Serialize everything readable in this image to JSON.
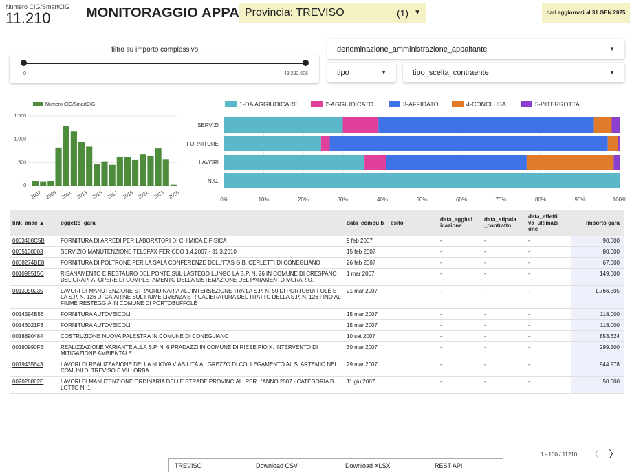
{
  "kpi": {
    "label": "Numero CIG/SmartCIG",
    "value": "11.210"
  },
  "header": {
    "title": "MONITORAGGIO APPALTI",
    "provincia_label": "Provincia: TREVISO",
    "provincia_count": "(1)",
    "updated": "dati aggiornati al 31.GEN.2025"
  },
  "filter": {
    "label": "filtro su importo complessivo",
    "min": "0",
    "max": "43.292.606",
    "position": [
      0,
      1
    ]
  },
  "dropdowns": {
    "amministrazione": "denominazione_amministrazione_appaltante",
    "tipo": "tipo",
    "scelta": "tipo_scelta_contraente"
  },
  "colors": {
    "bar_green": "#4c8c3b",
    "s1": "#5ab8c8",
    "s2": "#e0409a",
    "s3": "#3f72e6",
    "s4": "#e07b2c",
    "s5": "#8a3fcf"
  },
  "chart_data": [
    {
      "type": "bar",
      "legend": "Numero CIG/SmartCIG",
      "x": [
        2007,
        2008,
        2009,
        2010,
        2011,
        2012,
        2013,
        2014,
        2015,
        2016,
        2017,
        2018,
        2019,
        2020,
        2021,
        2022,
        2023,
        2024,
        2025
      ],
      "tick_labels": [
        "2007",
        "2009",
        "2011",
        "2013",
        "2015",
        "2017",
        "2019",
        "2021",
        "2023",
        "2025"
      ],
      "values": [
        90,
        80,
        95,
        820,
        1290,
        1170,
        950,
        840,
        470,
        510,
        450,
        610,
        620,
        550,
        680,
        640,
        800,
        560,
        20
      ],
      "yticks": [
        "0",
        "500",
        "1.000",
        "1.500"
      ],
      "ylim": [
        0,
        1500
      ]
    },
    {
      "type": "bar",
      "orientation": "horizontal-stacked-100",
      "categories": [
        "SERVIZI",
        "FORNITURE",
        "LAVORI",
        "N.C."
      ],
      "series": [
        {
          "name": "1-DA AGGIUDICARE",
          "values": [
            30,
            24.5,
            35.5,
            100
          ]
        },
        {
          "name": "2-AGGIUDICATO",
          "values": [
            9,
            2.2,
            5.5,
            0
          ]
        },
        {
          "name": "3-AFFIDATO",
          "values": [
            54.5,
            70.3,
            35.5,
            0
          ]
        },
        {
          "name": "4-CONCLUSA",
          "values": [
            4.5,
            2.5,
            22,
            0
          ]
        },
        {
          "name": "5-INTERROTTA",
          "values": [
            2,
            0.5,
            1.5,
            0
          ]
        }
      ],
      "xticks": [
        "0%",
        "10%",
        "20%",
        "30%",
        "40%",
        "50%",
        "60%",
        "70%",
        "80%",
        "90%",
        "100%"
      ],
      "xlim": [
        0,
        100
      ]
    }
  ],
  "table": {
    "headers": [
      "link_anac ▲",
      "oggetto_gara",
      "data_compu b",
      "esito",
      "data_aggiud icazione",
      "data_stipula _contratto",
      "data_effetti va_ultimazi one",
      "Importo gara"
    ],
    "rows": [
      [
        "0003408C5B",
        "FORNITURA DI ARREDI PER LABORATORI DI CHIMICA E FISICA",
        "9 feb 2007",
        "",
        "-",
        "-",
        "-",
        "90.000"
      ],
      [
        "0005138003",
        "SERVIZIO MANUTENZIONE TELEFAX PERIODO 1.4.2007 - 31.3.2010",
        "15 feb 2007",
        "",
        "-",
        "-",
        "-",
        "80.000"
      ],
      [
        "0008274BE8",
        "FORNITURA DI POLTRONE PER LA SALA CONFERENZE DELL'ITAS G.B. CERLETTI DI CONEGLIANO",
        "26 feb 2007",
        "",
        "-",
        "-",
        "-",
        "67.000"
      ],
      [
        "001099515C",
        "RISANAMENTO E RESTAURO DEL PONTE SUL LASTEGO LUNGO LA S.P. N. 26 IN COMUNE DI CRESPANO DEL GRAPPA. OPERE DI COMPLETAMENTO DELLA SISTEMAZIONE DEL PARAMENTO MURARIO.",
        "1 mar 2007",
        "",
        "-",
        "-",
        "-",
        "149.000"
      ],
      [
        "0013090235",
        "LAVORI DI MANUTENZIONE STRAORDINARIA ALL'INTERSEZIONE TRA LA S.P. N. 50 DI PORTOBUFFOLÈ E LA S.P. N. 126 DI GAIARINE SUL FIUME LIVENZA E RICALIBRATURA DEL TRATTO DELLA S.P. N. 126 FINO AL FIUME RESTEGGIA IN COMUNE DI PORTOBUFFOLÈ",
        "21 mar 2007",
        "",
        "-",
        "-",
        "-",
        "1.766.505"
      ],
      [
        "0014594B56",
        "FORNITURA AUTOVEICOLI",
        "15 mar 2007",
        "",
        "-",
        "-",
        "-",
        "118.000"
      ],
      [
        "00146021F3",
        "FORNITURA AUTOVEICOLI",
        "15 mar 2007",
        "",
        "-",
        "-",
        "-",
        "118.000"
      ],
      [
        "0018890484",
        "COSTRUZIONE NUOVA PALESTRA IN COMUNE DI CONEGLIANO",
        "10 set 2007",
        "",
        "-",
        "-",
        "-",
        "853.624"
      ],
      [
        "00190990FE",
        "REALIZZAZIONE VARIANTE ALLA S.P. N. 6 PRADAZZI IN COMUNE DI RIESE PIO X. INTERVENTO DI MITIGAZIONE AMBIENTALE.",
        "30 mar 2007",
        "",
        "-",
        "-",
        "-",
        "299.500"
      ],
      [
        "0019435643",
        "LAVORI DI REALIZZAZIONE DELLA NUOVA VIABILITÀ AL GREZZO DI COLLEGAMENTO AL S. ARTEMIO NEI COMUNI DI TREVISO E VILLORBA",
        "29 mar 2007",
        "",
        "-",
        "-",
        "-",
        "944.978"
      ],
      [
        "002028862E",
        "LAVORI DI MANUTENZIONE ORDINARIA DELLE STRADE PROVINCIALI PER L'ANNO 2007 - CATEGORIA B. LOTTO N. 1.",
        "11 giu 2007",
        "",
        "-",
        "-",
        "-",
        "50.000"
      ]
    ],
    "pager": "1 - 100 / 11210",
    "prev": "〈",
    "next": "〉"
  },
  "footer": {
    "city": "TREVISO",
    "csv": "Download CSV",
    "xlsx": "Download XLSX",
    "api": "REST API"
  }
}
